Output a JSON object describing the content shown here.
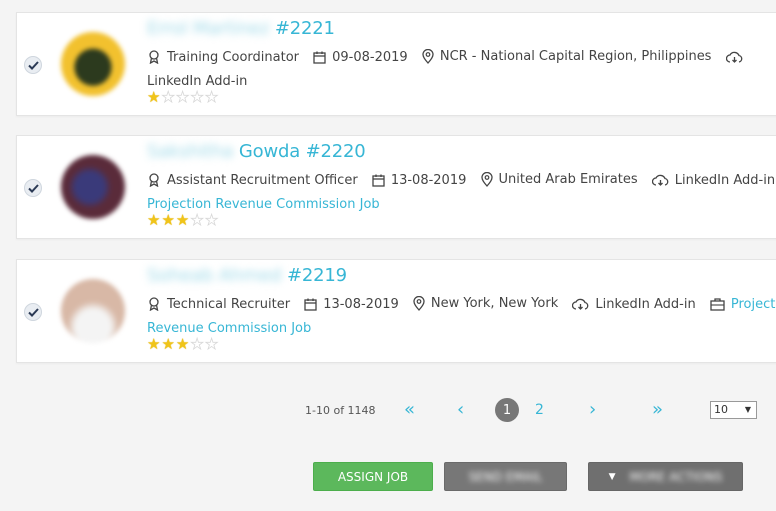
{
  "candidates": [
    {
      "name_hidden": "Errol Martinez",
      "name_visible": "",
      "id": "#2221",
      "title": "Training Coordinator",
      "date": "09-08-2019",
      "location": "NCR - National Capital Region, Philippines",
      "source": "LinkedIn Add-in",
      "job_line1": "",
      "job_line2": "",
      "rating": 1,
      "avatar_color": "#f2c12e",
      "avatar_center": "#2c3a1e"
    },
    {
      "name_hidden": "Sakshitha",
      "name_visible": "Gowda",
      "id": "#2220",
      "title": "Assistant Recruitment Officer",
      "date": "13-08-2019",
      "location": "United Arab Emirates",
      "source": "LinkedIn Add-in",
      "job_line1": "",
      "job_line2": "Projection Revenue Commission Job",
      "rating": 3,
      "avatar_color": "#5a2b3a",
      "avatar_center": "#3a3a7a"
    },
    {
      "name_hidden": "Soheab Ahmed",
      "name_visible": "",
      "id": "#2219",
      "title": "Technical Recruiter",
      "date": "13-08-2019",
      "location": "New York, New York",
      "source": "LinkedIn Add-in",
      "job_line1": "Projection",
      "job_line2": "Revenue Commission Job",
      "rating": 3,
      "avatar_color": "#d8b8a6",
      "avatar_center": "#f4f4f4"
    }
  ],
  "pagination": {
    "range": "1-10 of 1148",
    "current_page": "1",
    "next_page": "2",
    "first_glyph": "«",
    "prev_glyph": "‹",
    "next_glyph": "›",
    "last_glyph": "»",
    "page_size": "10"
  },
  "actions": {
    "assign_label": "ASSIGN JOB",
    "send_label": "SEND EMAIL",
    "more_label": "MORE ACTIONS"
  },
  "colors": {
    "accent": "#37b6d5",
    "assign": "#5cb85c",
    "grey_button": "#777777"
  }
}
